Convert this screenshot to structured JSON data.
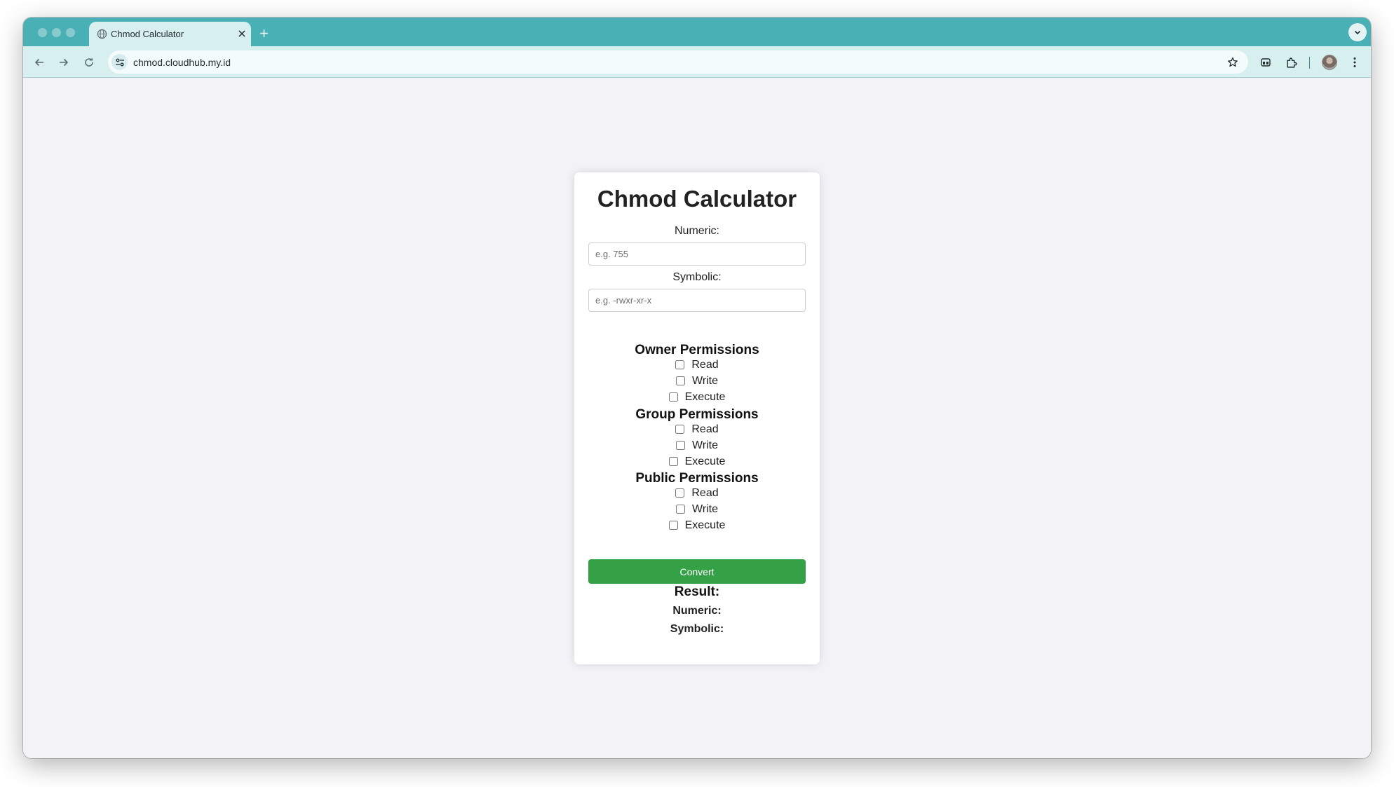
{
  "browser": {
    "tab_title": "Chmod Calculator",
    "url": "chmod.cloudhub.my.id",
    "accent_color": "#49b0b5"
  },
  "app": {
    "title": "Chmod Calculator",
    "numeric_label": "Numeric:",
    "numeric_placeholder": "e.g. 755",
    "symbolic_label": "Symbolic:",
    "symbolic_placeholder": "e.g. -rwxr-xr-x",
    "permissions": [
      {
        "title": "Owner Permissions",
        "options": [
          {
            "label": "Read",
            "checked": false
          },
          {
            "label": "Write",
            "checked": false
          },
          {
            "label": "Execute",
            "checked": false
          }
        ]
      },
      {
        "title": "Group Permissions",
        "options": [
          {
            "label": "Read",
            "checked": false
          },
          {
            "label": "Write",
            "checked": false
          },
          {
            "label": "Execute",
            "checked": false
          }
        ]
      },
      {
        "title": "Public Permissions",
        "options": [
          {
            "label": "Read",
            "checked": false
          },
          {
            "label": "Write",
            "checked": false
          },
          {
            "label": "Execute",
            "checked": false
          }
        ]
      }
    ],
    "convert_label": "Convert",
    "convert_color": "#34a146",
    "result_title": "Result:",
    "result_numeric_label": "Numeric:",
    "result_numeric_value": "",
    "result_symbolic_label": "Symbolic:",
    "result_symbolic_value": ""
  }
}
